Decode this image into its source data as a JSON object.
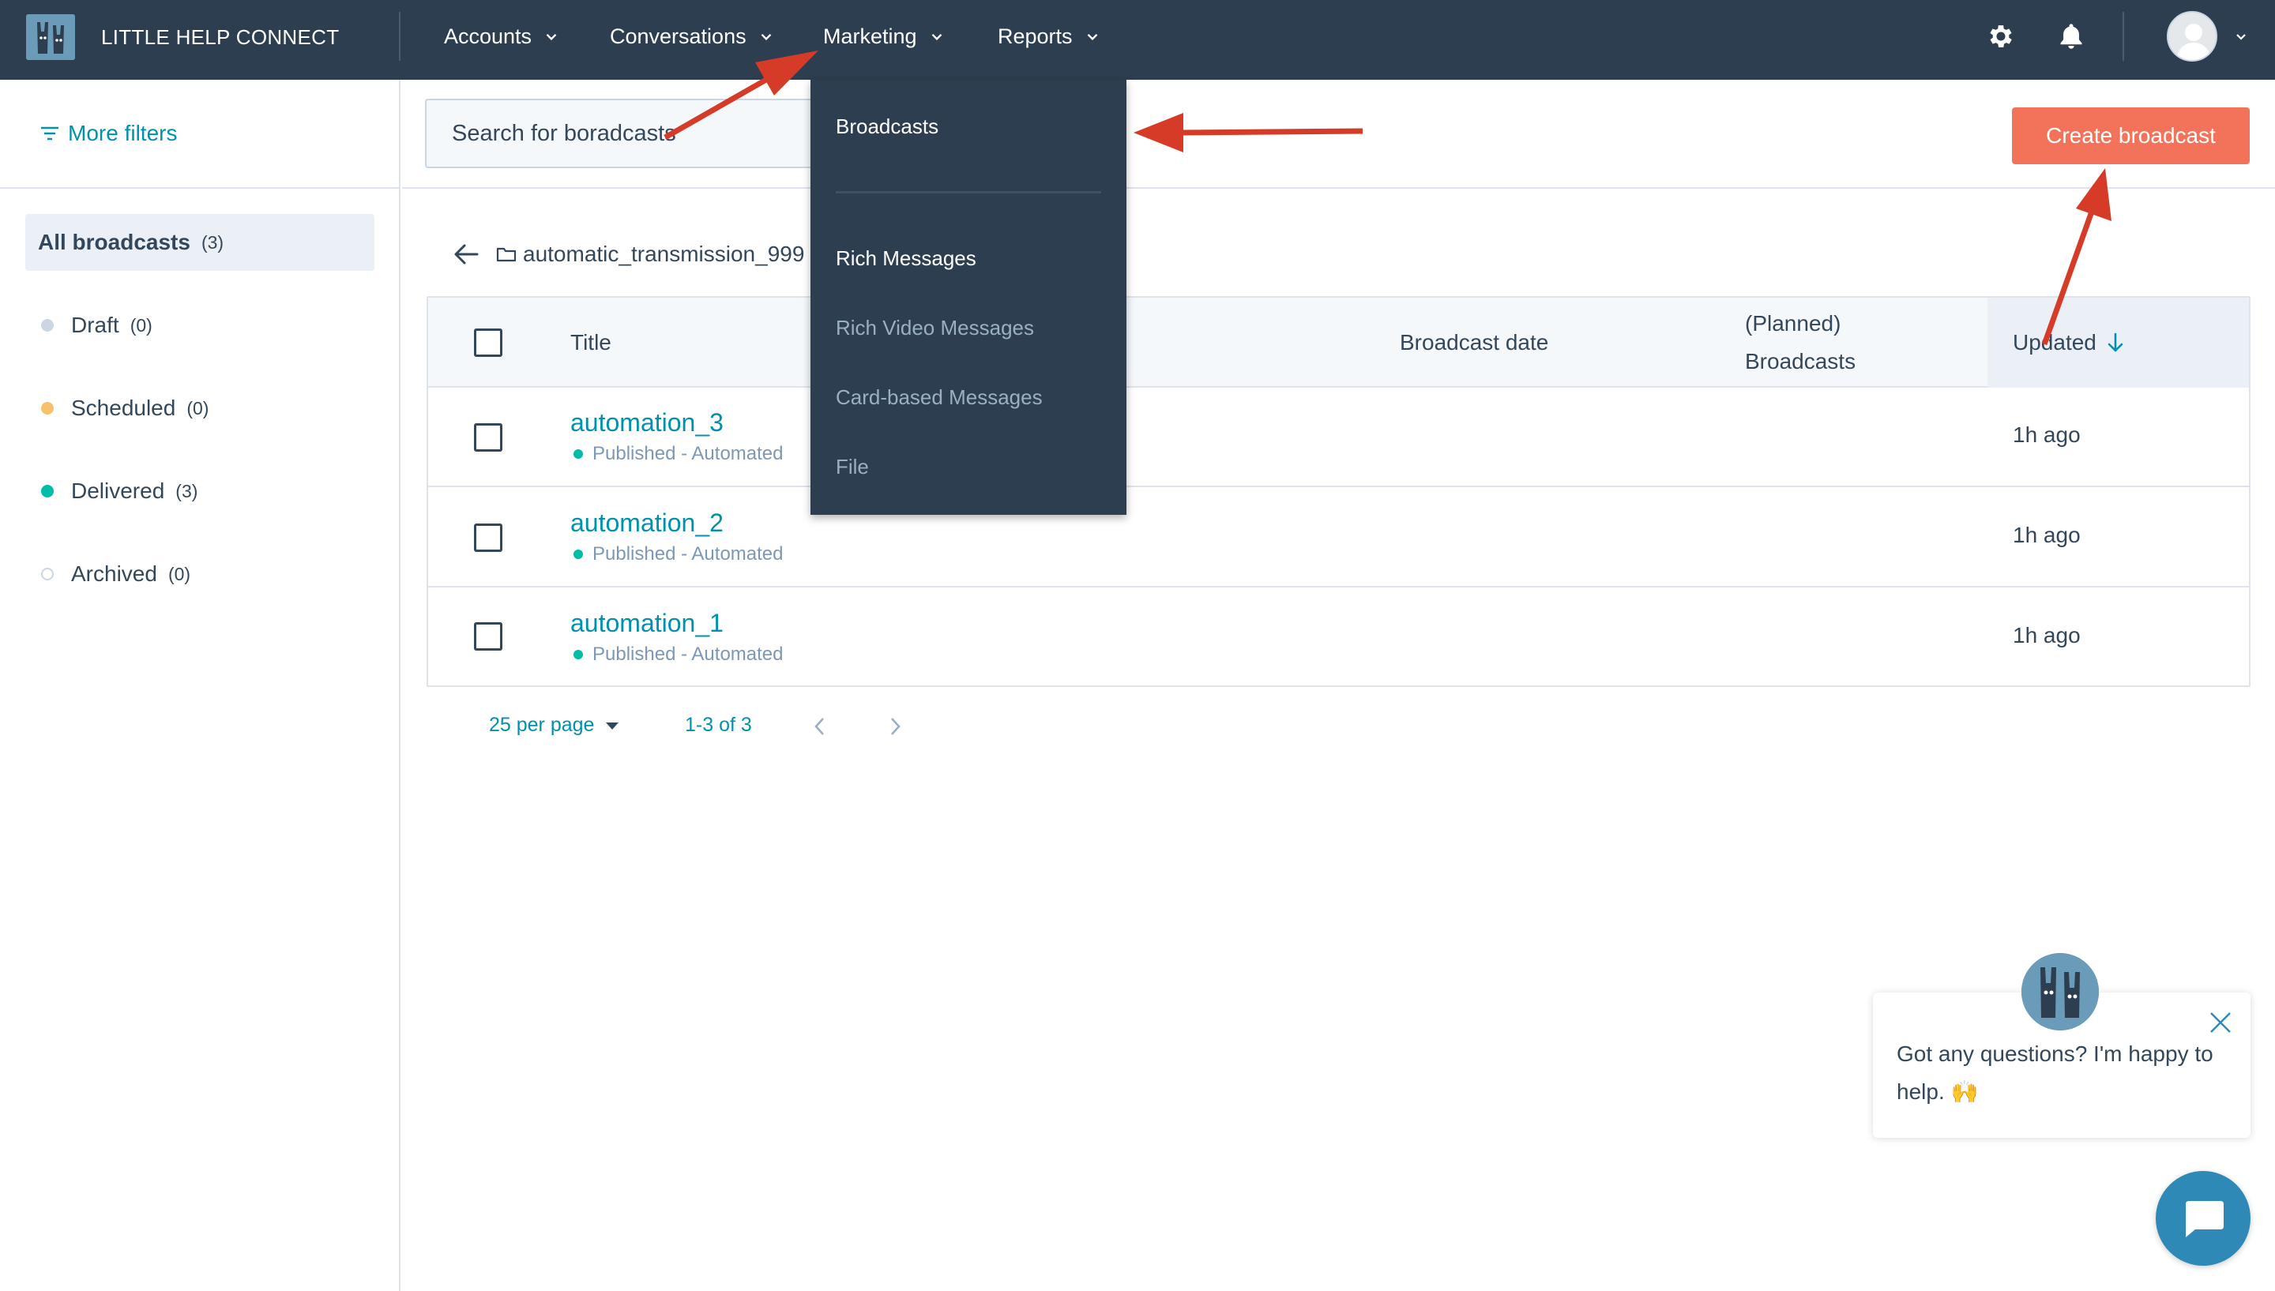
{
  "app": {
    "title": "LITTLE HELP CONNECT"
  },
  "nav": {
    "items": [
      {
        "label": "Accounts"
      },
      {
        "label": "Conversations"
      },
      {
        "label": "Marketing"
      },
      {
        "label": "Reports"
      }
    ]
  },
  "topbar_icons": {
    "settings": "gear-icon",
    "notifications": "bell-icon",
    "profile": "avatar"
  },
  "sidebar": {
    "more_filters": "More filters",
    "items": [
      {
        "label": "All broadcasts",
        "count": "(3)",
        "color": ""
      },
      {
        "label": "Draft",
        "count": "(0)",
        "color": "#cbd6e2"
      },
      {
        "label": "Scheduled",
        "count": "(0)",
        "color": "#f5c26b"
      },
      {
        "label": "Delivered",
        "count": "(3)",
        "color": "#00bda5"
      },
      {
        "label": "Archived",
        "count": "(0)",
        "color": "#ffffff"
      }
    ]
  },
  "search": {
    "value": "Search for boradcasts"
  },
  "create_button": "Create broadcast",
  "folder": {
    "name": "automatic_transmission_999"
  },
  "table": {
    "headers": {
      "title": "Title",
      "broadcast_date": "Broadcast date",
      "planned_line1": "(Planned)",
      "planned_line2": "Broadcasts",
      "updated": "Updated"
    },
    "rows": [
      {
        "title": "automation_3",
        "status": "Published - Automated",
        "updated": "1h ago"
      },
      {
        "title": "automation_2",
        "status": "Published - Automated",
        "updated": "1h ago"
      },
      {
        "title": "automation_1",
        "status": "Published - Automated",
        "updated": "1h ago"
      }
    ]
  },
  "pagination": {
    "per_page": "25 per page",
    "range": "1-3 of 3"
  },
  "dropdown": {
    "items": [
      {
        "label": "Broadcasts",
        "color": "#ffffff"
      },
      {
        "label": "Rich Messages",
        "color": "#ffffff"
      },
      {
        "label": "Rich Video Messages",
        "color": "#99afc4"
      },
      {
        "label": "Card-based Messages",
        "color": "#99afc4"
      },
      {
        "label": "File",
        "color": "#99afc4"
      }
    ]
  },
  "chat": {
    "message": "Got any questions? I'm happy to help. 🙌"
  },
  "colors": {
    "topbar": "#2d3e50",
    "accent": "#0091ae",
    "create": "#f2735a",
    "annotation": "#d63b27"
  }
}
